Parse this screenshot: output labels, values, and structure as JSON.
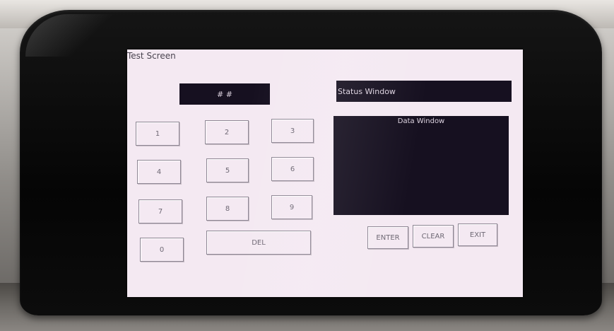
{
  "screen": {
    "title": "Test Screen",
    "code_display": "# #",
    "status_window": "Status Window",
    "data_window_label": "Data Window"
  },
  "keypad": {
    "k1": "1",
    "k2": "2",
    "k3": "3",
    "k4": "4",
    "k5": "5",
    "k6": "6",
    "k7": "7",
    "k8": "8",
    "k9": "9",
    "k0": "0",
    "del": "DEL"
  },
  "actions": {
    "enter": "ENTER",
    "clear": "CLEAR",
    "exit": "EXIT"
  }
}
